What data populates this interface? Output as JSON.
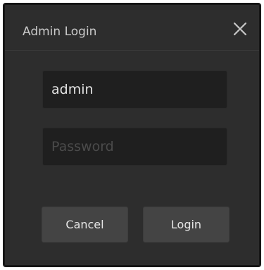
{
  "dialog": {
    "title": "Admin Login",
    "close_icon": "close-icon"
  },
  "form": {
    "username_value": "admin",
    "password_value": "",
    "password_placeholder": "Password"
  },
  "buttons": {
    "cancel_label": "Cancel",
    "login_label": "Login"
  },
  "colors": {
    "dialog_background": "#2d2d2d",
    "field_background": "#1f1f1f",
    "button_background": "#444444"
  }
}
